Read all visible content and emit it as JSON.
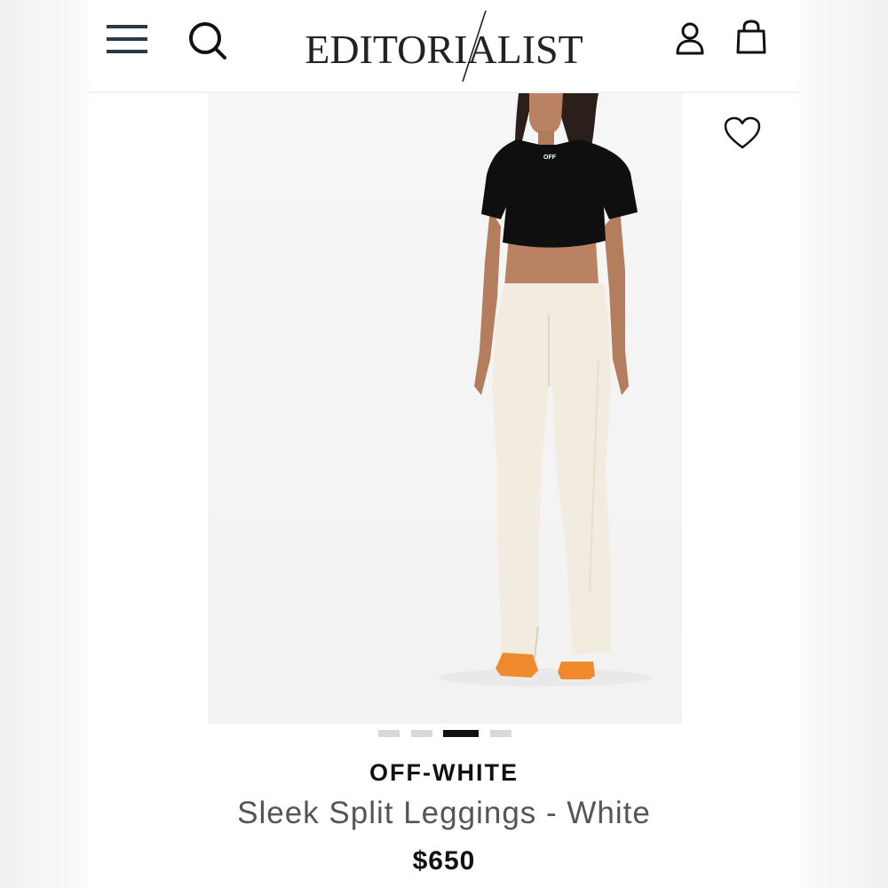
{
  "header": {
    "logo_text": "EDITORIALIST",
    "menu_icon": "hamburger-menu-icon",
    "search_icon": "search-icon",
    "account_icon": "user-icon",
    "bag_icon": "shopping-bag-icon"
  },
  "product": {
    "favorite_icon": "heart-icon",
    "shirt_print": "OFF",
    "image_count": 4,
    "active_image": 3,
    "brand": "OFF-WHITE",
    "title": "Sleek Split Leggings - White",
    "price": "$650"
  },
  "colors": {
    "page_bg": "#ffffff",
    "image_bg": "#f4f4f4",
    "text_dark": "#111111",
    "text_muted": "#555555",
    "dot_active": "#111111",
    "dot_inactive": "#d8d8d8",
    "sandal": "#f0892c"
  }
}
